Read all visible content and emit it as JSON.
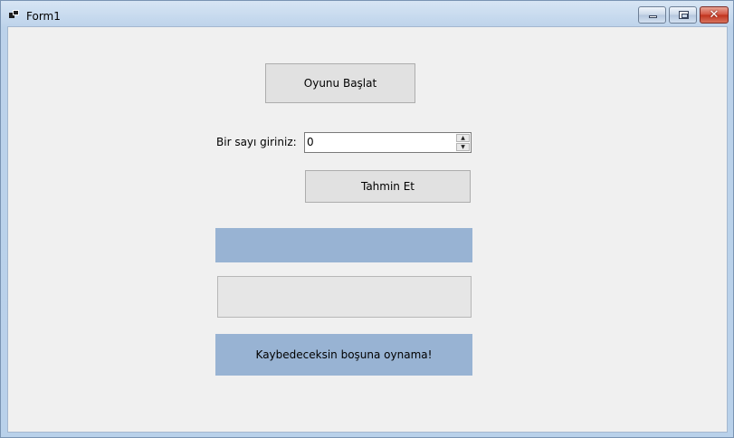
{
  "window": {
    "title": "Form1",
    "minimize_label": "",
    "maximize_label": "",
    "close_label": "✕"
  },
  "form": {
    "start_button_label": "Oyunu Başlat",
    "prompt_label": "Bir sayı giriniz:",
    "number_input_value": "0",
    "spin_up_glyph": "▲",
    "spin_down_glyph": "▼",
    "guess_button_label": "Tahmin Et",
    "result_label_text": "",
    "hint_box_text": "",
    "message_label_text": "Kaybedeceksin boşuna oynama!"
  },
  "colors": {
    "client_background": "#f0f0f0",
    "panel_blue": "#98b3d3",
    "button_face": "#e1e1e1"
  }
}
